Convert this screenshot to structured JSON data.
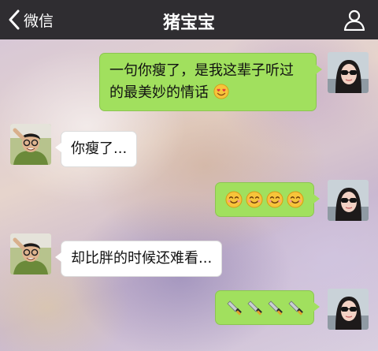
{
  "header": {
    "back_label": "微信",
    "title": "猪宝宝",
    "back_icon": "chevron-left-icon",
    "profile_icon": "person-icon"
  },
  "colors": {
    "navbar": "#2f2d31",
    "outgoing_bubble": "#a1e05e",
    "incoming_bubble": "#ffffff"
  },
  "messages": [
    {
      "direction": "out",
      "text": "一句你瘦了，是我这辈子听过的最美妙的情话",
      "emoji": "heart-eyes-smiley-icon"
    },
    {
      "direction": "in",
      "text": "你瘦了..."
    },
    {
      "direction": "out",
      "emoji": "smiley-icon",
      "emoji_count": 4
    },
    {
      "direction": "in",
      "text": "却比胖的时候还难看..."
    },
    {
      "direction": "out",
      "emoji": "knife-icon",
      "emoji_count": 4
    }
  ],
  "avatars": {
    "self": "woman-sunglasses-avatar",
    "contact": "man-glasses-avatar"
  }
}
